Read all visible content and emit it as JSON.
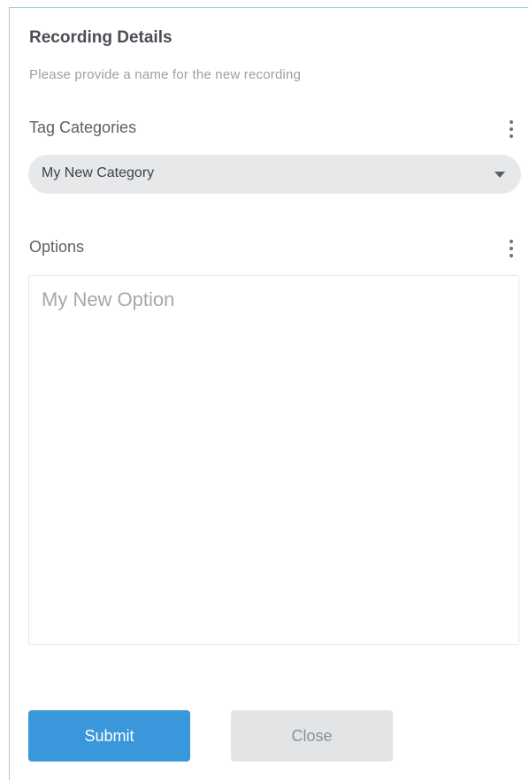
{
  "form": {
    "title": "Recording Details",
    "subtitle": "Please provide a name for the new recording",
    "tag_categories": {
      "label": "Tag Categories",
      "menu_icon": "more-vertical-icon",
      "selected_value": "My New Category"
    },
    "options": {
      "label": "Options",
      "menu_icon": "more-vertical-icon",
      "placeholder": "My New Option"
    },
    "buttons": {
      "submit_label": "Submit",
      "close_label": "Close"
    }
  },
  "colors": {
    "accent": "#3b97db",
    "panel_border": "#a9cbe4",
    "select_bg": "#e7e8ea",
    "close_bg": "#e3e4e6"
  }
}
